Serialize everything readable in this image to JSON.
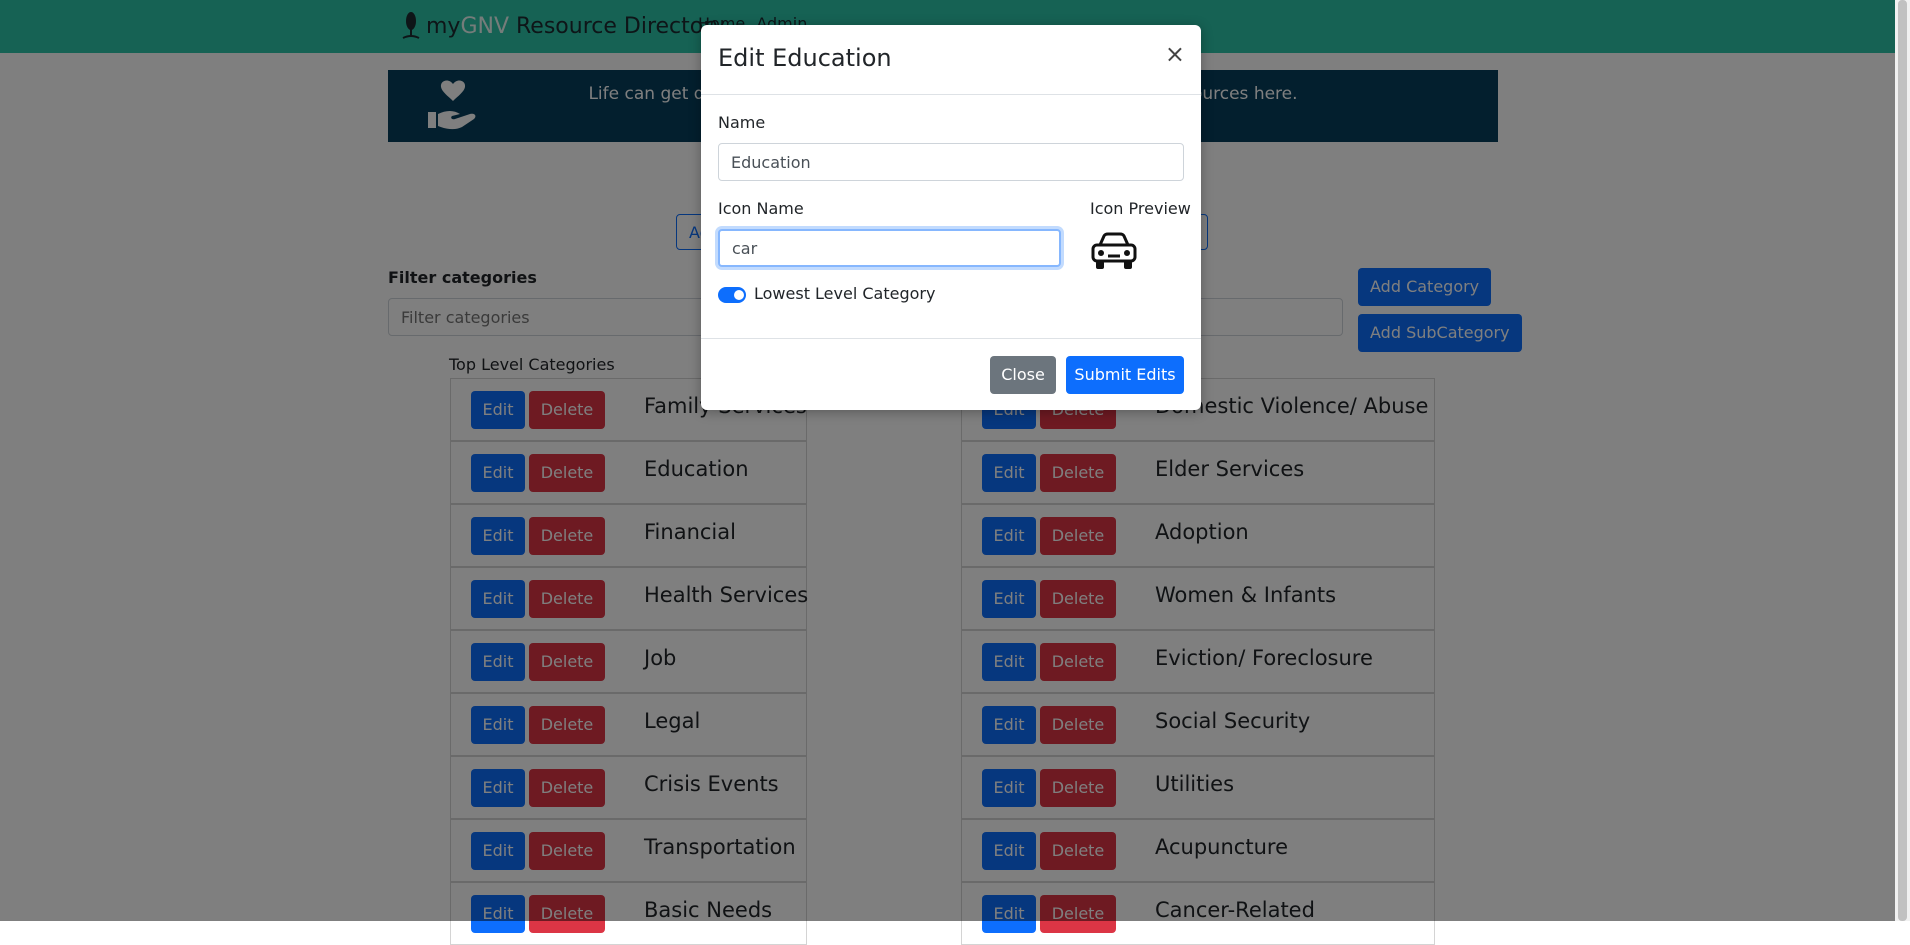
{
  "navbar": {
    "brand_prefix": "my",
    "brand_accent": "GNV",
    "brand_suffix": " Resource Directory",
    "links": [
      "Home",
      "Admin"
    ]
  },
  "banner": {
    "text": "Life can get difficult sometimes. Find local community services and resources here."
  },
  "page_buttons": {
    "add_outline_left": "Add",
    "add_category": "Add Category",
    "add_subcategory": "Add SubCategory"
  },
  "filter": {
    "label": "Filter categories",
    "placeholder": "Filter categories"
  },
  "top_level_heading": "Top Level Categories",
  "row_buttons": {
    "edit": "Edit",
    "delete": "Delete"
  },
  "left_categories": [
    "Family Services",
    "Education",
    "Financial",
    "Health Services",
    "Job",
    "Legal",
    "Crisis Events",
    "Transportation",
    "Basic Needs"
  ],
  "right_categories": [
    "Domestic Violence/ Abuse",
    "Elder Services",
    "Adoption",
    "Women & Infants",
    "Eviction/ Foreclosure",
    "Social Security",
    "Utilities",
    "Acupuncture",
    "Cancer-Related"
  ],
  "modal": {
    "title": "Edit Education",
    "close_symbol": "×",
    "name_label": "Name",
    "name_value": "Education",
    "icon_name_label": "Icon Name",
    "icon_name_value": "car",
    "icon_preview_label": "Icon Preview",
    "icon_preview": "car-icon",
    "lowest_level_label": "Lowest Level Category",
    "lowest_level_checked": true,
    "close_button": "Close",
    "submit_button": "Submit Edits"
  },
  "colors": {
    "navbar": "#2cc4a8",
    "banner": "#073f5c",
    "primary": "#0d6efd",
    "danger": "#dc3545",
    "secondary": "#6c757d"
  }
}
